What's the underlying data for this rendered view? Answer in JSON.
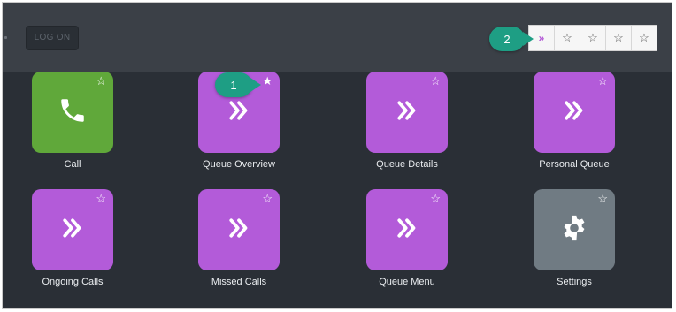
{
  "topbar": {
    "logon_label": "LOG ON",
    "favorites": [
      "»",
      "☆",
      "☆",
      "☆",
      "☆"
    ]
  },
  "callouts": [
    "1",
    "2"
  ],
  "tiles": [
    {
      "label": "Call",
      "icon": "phone-icon",
      "color": "#60a83a",
      "star": "☆"
    },
    {
      "label": "Queue Overview",
      "icon": "double-chevron-icon",
      "color": "#b35bd9",
      "star": "★"
    },
    {
      "label": "Queue Details",
      "icon": "double-chevron-icon",
      "color": "#b35bd9",
      "star": "☆"
    },
    {
      "label": "Personal Queue",
      "icon": "double-chevron-icon",
      "color": "#b35bd9",
      "star": "☆"
    },
    {
      "label": "Ongoing Calls",
      "icon": "double-chevron-icon",
      "color": "#b35bd9",
      "star": "☆"
    },
    {
      "label": "Missed Calls",
      "icon": "double-chevron-icon",
      "color": "#b35bd9",
      "star": "☆"
    },
    {
      "label": "Queue Menu",
      "icon": "double-chevron-icon",
      "color": "#b35bd9",
      "star": "☆"
    },
    {
      "label": "Settings",
      "icon": "gear-icon",
      "color": "#707b83",
      "star": "☆"
    }
  ]
}
